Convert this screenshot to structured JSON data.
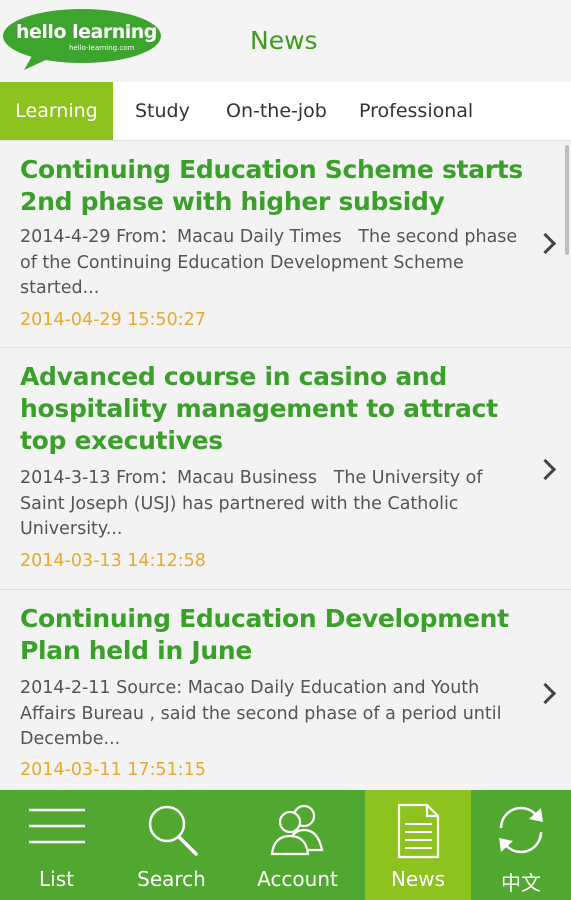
{
  "header": {
    "logo_text": "hello learning",
    "logo_subtext": "hello-learning.com",
    "title": "News"
  },
  "tabs": [
    {
      "label": "Learning",
      "active": true
    },
    {
      "label": "Study",
      "active": false
    },
    {
      "label": "On-the-job",
      "active": false
    },
    {
      "label": "Professional",
      "active": false
    }
  ],
  "news": [
    {
      "title": "Continuing Education Scheme starts 2nd phase with higher subsidy",
      "summary": "2014-4-29 From：Macau Daily Times   The second phase of the Continuing Education Development Scheme started...",
      "date": "2014-04-29 15:50:27"
    },
    {
      "title": "Advanced course in casino and hospitality management to attract top executives",
      "summary": "2014-3-13 From：Macau Business   The University of Saint Joseph (USJ) has partnered with the Catholic University...",
      "date": "2014-03-13 14:12:58"
    },
    {
      "title": "Continuing Education Development Plan held in June",
      "summary": "2014-2-11 Source: Macao Daily Education and Youth Affairs Bureau , said the second phase of a period until Decembe...",
      "date": "2014-03-11 17:51:15"
    }
  ],
  "bottom_nav": [
    {
      "label": "List",
      "icon": "list-icon",
      "active": false
    },
    {
      "label": "Search",
      "icon": "search-icon",
      "active": false
    },
    {
      "label": "Account",
      "icon": "account-icon",
      "active": false
    },
    {
      "label": "News",
      "icon": "news-icon",
      "active": true
    },
    {
      "label": "中文",
      "icon": "refresh-language-icon",
      "active": false
    }
  ],
  "colors": {
    "brand_green": "#3f9b1f",
    "accent_lime": "#8dc21f",
    "nav_green": "#51a830",
    "date_orange": "#e8a92c"
  }
}
